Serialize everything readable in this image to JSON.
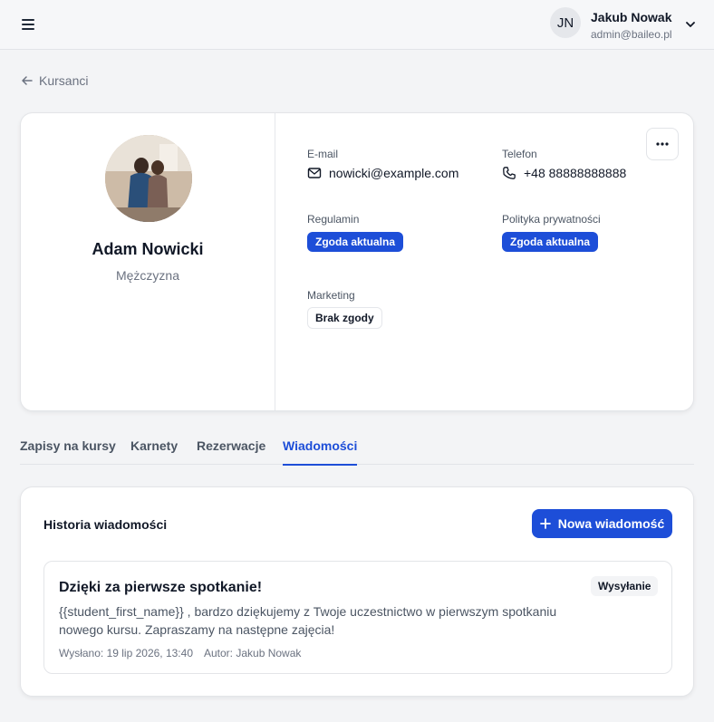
{
  "header": {
    "user_initials": "JN",
    "user_name": "Jakub Nowak",
    "user_email": "admin@baileo.pl"
  },
  "breadcrumb": {
    "back_label": "Kursanci"
  },
  "student": {
    "name": "Adam Nowicki",
    "gender": "Mężczyzna",
    "email_label": "E-mail",
    "email": "nowicki@example.com",
    "phone_label": "Telefon",
    "phone": "+48 88888888888",
    "terms_label": "Regulamin",
    "terms_status": "Zgoda aktualna",
    "privacy_label": "Polityka prywatności",
    "privacy_status": "Zgoda aktualna",
    "marketing_label": "Marketing",
    "marketing_status": "Brak zgody"
  },
  "tabs": [
    {
      "label": "Zapisy na kursy",
      "active": false
    },
    {
      "label": "Karnety",
      "active": false
    },
    {
      "label": "Rezerwacje",
      "active": false
    },
    {
      "label": "Wiadomości",
      "active": true
    }
  ],
  "messages": {
    "title": "Historia wiadomości",
    "new_button_label": "Nowa wiadomość",
    "items": [
      {
        "title": "Dzięki za pierwsze spotkanie!",
        "status": "Wysyłanie",
        "body": "{{student_first_name}} , bardzo dziękujemy z Twoje uczestnictwo w pierwszym spotkaniu nowego kursu. Zapraszamy na następne zajęcia!",
        "sent": "Wysłano: 19 lip 2026, 13:40",
        "author": "Autor: Jakub Nowak"
      }
    ]
  },
  "colors": {
    "accent": "#1d4ed8",
    "background": "#f3f4f6"
  }
}
